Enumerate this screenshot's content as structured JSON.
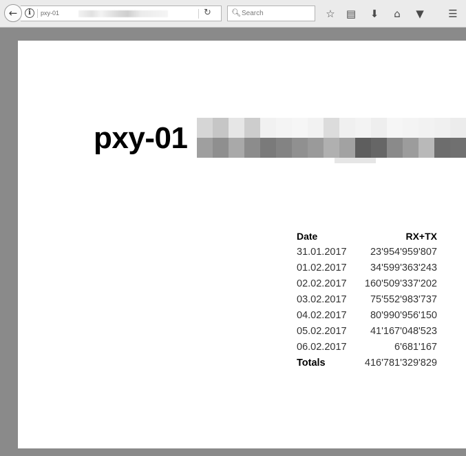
{
  "browser": {
    "url_text": "pxy-01",
    "search_placeholder": "Search",
    "icons": {
      "back": "back-arrow-icon",
      "info": "info-icon",
      "reload": "reload-icon",
      "search": "search-icon",
      "bookmark_star": "bookmark-star-icon",
      "reading_list": "reading-list-icon",
      "downloads": "downloads-icon",
      "home": "home-icon",
      "pocket": "pocket-icon",
      "menu": "hamburger-menu-icon"
    }
  },
  "page": {
    "title": "pxy-01",
    "table": {
      "headers": {
        "date": "Date",
        "value": "RX+TX"
      },
      "rows": [
        {
          "date": "31.01.2017",
          "value": "23'954'959'807"
        },
        {
          "date": "01.02.2017",
          "value": "34'599'363'243"
        },
        {
          "date": "02.02.2017",
          "value": "160'509'337'202"
        },
        {
          "date": "03.02.2017",
          "value": "75'552'983'737"
        },
        {
          "date": "04.02.2017",
          "value": "80'990'956'150"
        },
        {
          "date": "05.02.2017",
          "value": "41'167'048'523"
        },
        {
          "date": "06.02.2017",
          "value": "6'681'167"
        }
      ],
      "totals": {
        "label": "Totals",
        "value": "416'781'329'829"
      }
    }
  },
  "colors": {
    "toolbar_bg": "#ebebeb",
    "frame_gray": "#8a8a8a",
    "page_bg": "#ffffff",
    "title_text": "#000000"
  }
}
